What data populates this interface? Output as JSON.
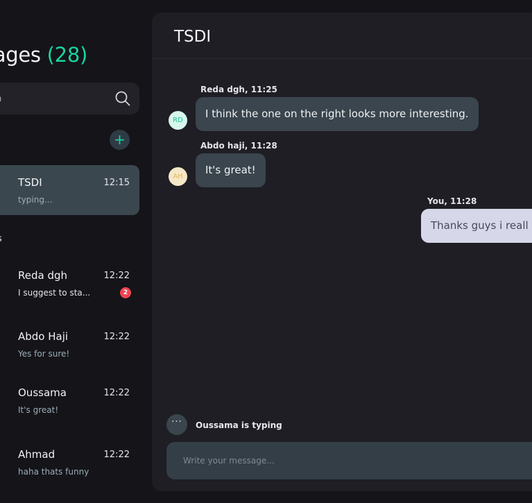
{
  "sidebar": {
    "title": "sages",
    "count": "(28)",
    "search": {
      "placeholder": "h",
      "value": ""
    },
    "add_icon": "plus-icon",
    "section_label": "s",
    "conversations": [
      {
        "name": "TSDI",
        "time": "12:15",
        "preview": "typing...",
        "active": true,
        "avatar_color": "#19d3a0"
      },
      {
        "name": "Reda dgh",
        "time": "12:22",
        "preview": "I suggest to sta...",
        "unread": "2",
        "online": true
      },
      {
        "name": "Abdo Haji",
        "time": "12:22",
        "preview": "Yes for sure!"
      },
      {
        "name": "Oussama",
        "time": "12:22",
        "preview": "It's great!",
        "online": true
      },
      {
        "name": "Ahmad",
        "time": "12:22",
        "preview": "haha thats funny"
      }
    ]
  },
  "chat": {
    "title": "TSDI",
    "messages": [
      {
        "meta": "Reda dgh, 11:25",
        "text": "I think the one on the right looks more interesting.",
        "initials": "RD",
        "avatar_bg": "#d7f6ec",
        "avatar_fg": "#19c497"
      },
      {
        "meta": "Abdo haji, 11:28",
        "text": "It's great!",
        "initials": "AH",
        "avatar_bg": "#f6e8c7",
        "avatar_fg": "#e0b860"
      },
      {
        "meta": "You, 11:28",
        "text": "Thanks guys i reall",
        "mine": true
      }
    ],
    "typing_dots": "···",
    "typing_text": "Oussama is typing",
    "composer_placeholder": "Write your message..."
  },
  "colors": {
    "accent": "#19d3a0",
    "badge": "#f04552",
    "active_row": "#3b474f",
    "my_bubble": "#d6d7e8"
  }
}
